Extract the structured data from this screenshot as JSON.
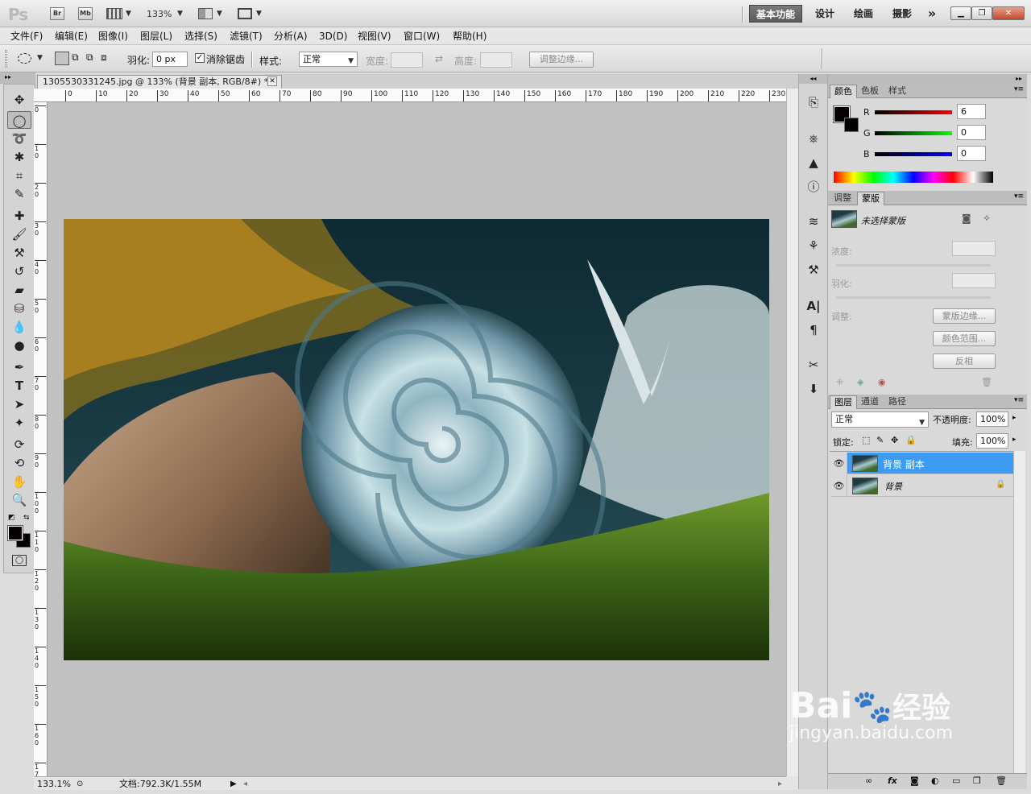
{
  "app": {
    "logo": "Ps",
    "bridge_label": "Br",
    "minibridge_label": "Mb",
    "zoom_value": "133%",
    "workspaces": [
      "基本功能",
      "设计",
      "绘画",
      "摄影"
    ],
    "more_workspaces": "»"
  },
  "menu": [
    "文件(F)",
    "编辑(E)",
    "图像(I)",
    "图层(L)",
    "选择(S)",
    "滤镜(T)",
    "分析(A)",
    "3D(D)",
    "视图(V)",
    "窗口(W)",
    "帮助(H)"
  ],
  "options": {
    "feather_label": "羽化:",
    "feather_value": "0 px",
    "antialias_label": "消除锯齿",
    "antialias_checked": true,
    "style_label": "样式:",
    "style_value": "正常",
    "width_label": "宽度:",
    "height_label": "高度:",
    "refine_edge": "调整边缘..."
  },
  "document": {
    "tab_title": "1305530331245.jpg @ 133% (背景 副本, RGB/8#) *",
    "zoom_status": "133.1%",
    "doc_info": "文档:792.3K/1.55M",
    "ruler_h": [
      "0",
      "10",
      "20",
      "30",
      "40",
      "50",
      "60",
      "70",
      "80",
      "90",
      "100",
      "110",
      "120",
      "130",
      "140",
      "150",
      "160",
      "170",
      "180",
      "190",
      "200",
      "210",
      "220",
      "230"
    ],
    "ruler_v": [
      "0",
      "1\n0",
      "2\n0",
      "3\n0",
      "4\n0",
      "5\n0",
      "6\n0",
      "7\n0",
      "8\n0",
      "9\n0",
      "1\n0\n0",
      "1\n1\n0",
      "1\n2\n0",
      "1\n3\n0",
      "1\n4\n0",
      "1\n5\n0",
      "1\n6\n0",
      "1\n7\n0"
    ]
  },
  "color_panel": {
    "tabs": [
      "颜色",
      "色板",
      "样式"
    ],
    "r_label": "R",
    "r_value": "6",
    "g_label": "G",
    "g_value": "0",
    "b_label": "B",
    "b_value": "0"
  },
  "mask_panel": {
    "tabs": [
      "调整",
      "蒙版"
    ],
    "no_mask": "未选择蒙版",
    "density_label": "浓度:",
    "feather_label": "羽化:",
    "refine_label": "调整:",
    "mask_edge_btn": "蒙版边缘...",
    "color_range_btn": "颜色范围...",
    "invert_btn": "反相"
  },
  "layers_panel": {
    "tabs": [
      "图层",
      "通道",
      "路径"
    ],
    "blend_mode": "正常",
    "opacity_label": "不透明度:",
    "opacity_value": "100%",
    "lock_label": "锁定:",
    "fill_label": "填充:",
    "fill_value": "100%",
    "layers": [
      {
        "name": "背景 副本",
        "selected": true
      },
      {
        "name": "背景",
        "selected": false
      }
    ]
  },
  "watermark": {
    "text": "Bai",
    "text2": "经验",
    "url": "jingyan.baidu.com"
  },
  "colors": {
    "selection": "#3d9cf2",
    "foreground": "#060000",
    "background": "#000000"
  }
}
